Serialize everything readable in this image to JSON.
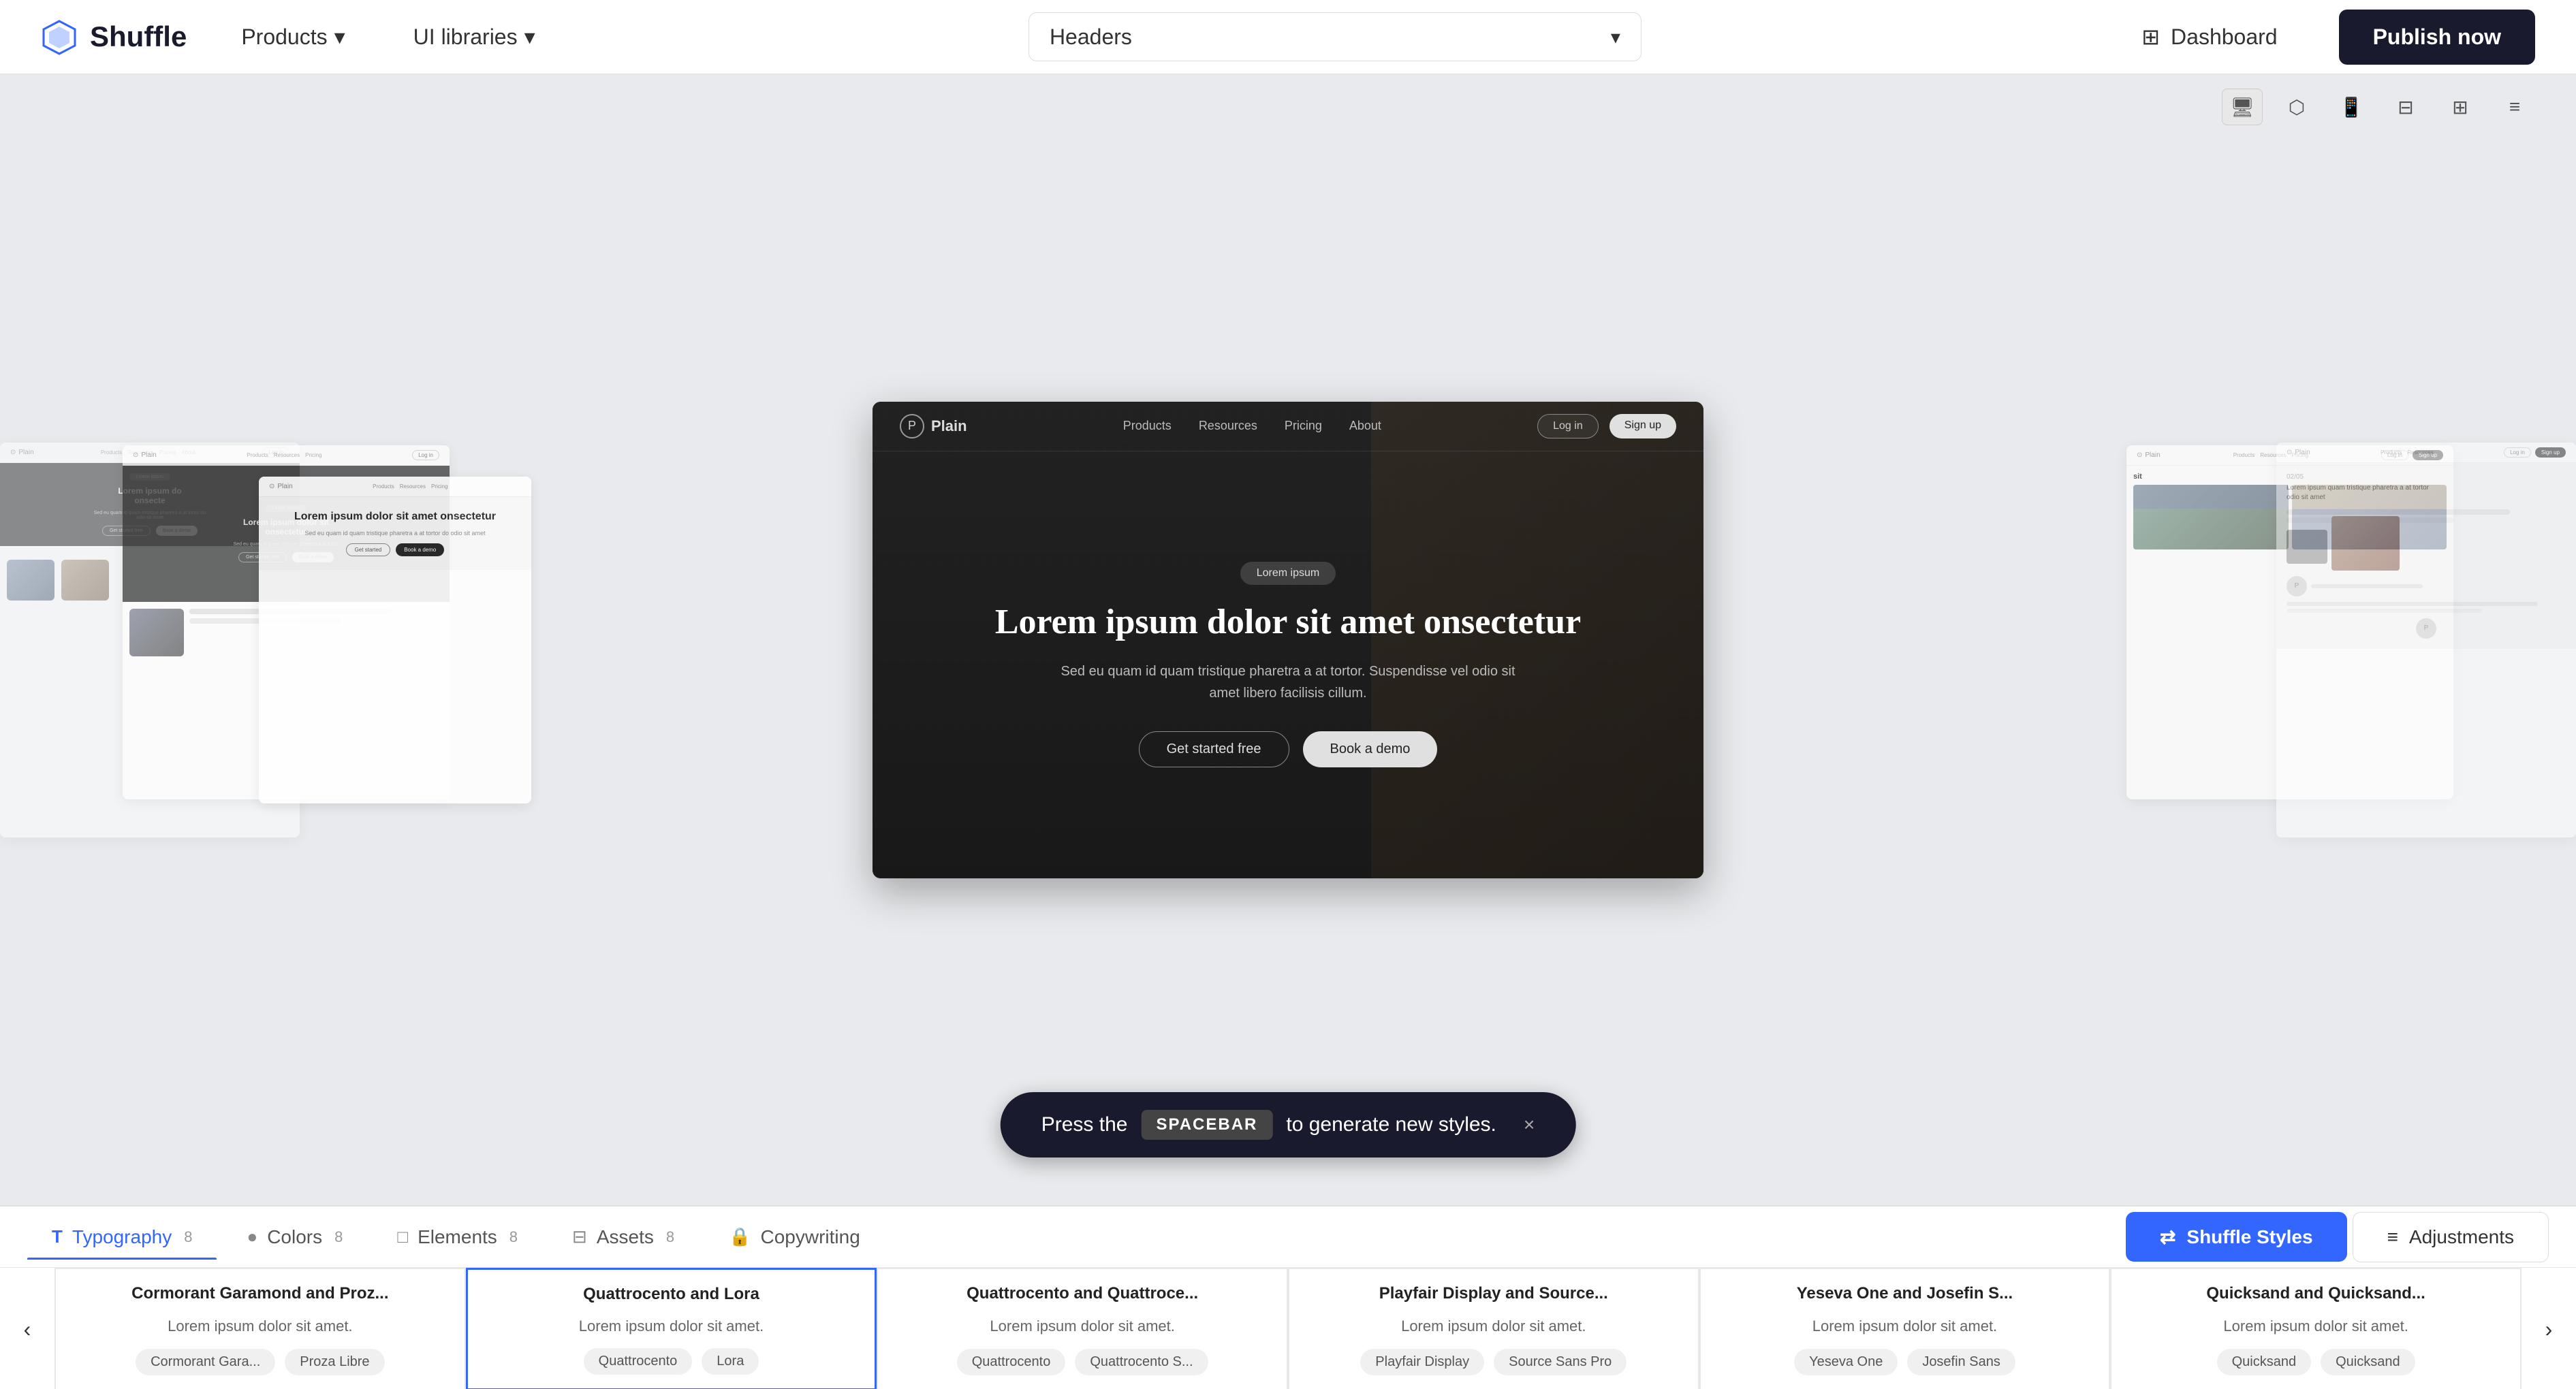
{
  "brand": {
    "name": "Shuffle",
    "logo_unicode": "⬡"
  },
  "topnav": {
    "products_label": "Products",
    "ui_libraries_label": "UI libraries",
    "search_placeholder": "Headers",
    "dashboard_label": "Dashboard",
    "publish_label": "Publish now"
  },
  "view_controls": [
    {
      "name": "desktop-view",
      "icon": "🖥",
      "active": true
    },
    {
      "name": "tablet-view",
      "icon": "⊟",
      "active": false
    },
    {
      "name": "mobile-view",
      "icon": "📱",
      "active": false
    },
    {
      "name": "split-view",
      "icon": "⊞",
      "active": false
    },
    {
      "name": "grid-view",
      "icon": "⊡",
      "active": false
    },
    {
      "name": "compact-view",
      "icon": "≡",
      "active": false
    }
  ],
  "preview": {
    "nav": {
      "logo": "Plain",
      "links": [
        "Products",
        "Resources",
        "Pricing",
        "About"
      ],
      "login_label": "Log in",
      "signup_label": "Sign up"
    },
    "hero": {
      "badge": "Lorem ipsum",
      "title": "Lorem ipsum dolor sit amet onsectetur",
      "subtitle": "Sed eu quam id quam tristique pharetra a at tortor. Suspendisse vel odio sit amet libero facilisis cillum.",
      "cta_primary": "Get started free",
      "cta_secondary": "Book a demo"
    }
  },
  "toast": {
    "prefix": "Press the",
    "key": "SPACEBAR",
    "suffix": "to generate new styles.",
    "close": "×"
  },
  "bottom_panel": {
    "tabs": [
      {
        "id": "typography",
        "label": "Typography",
        "badge": "8",
        "active": true,
        "icon": "T"
      },
      {
        "id": "colors",
        "label": "Colors",
        "badge": "8",
        "active": false,
        "icon": "●"
      },
      {
        "id": "elements",
        "label": "Elements",
        "badge": "8",
        "active": false,
        "icon": "□"
      },
      {
        "id": "assets",
        "label": "Assets",
        "badge": "8",
        "active": false,
        "icon": "⊟"
      },
      {
        "id": "copywriting",
        "label": "Copywriting",
        "badge": "",
        "active": false,
        "icon": "🔒",
        "locked": true
      }
    ],
    "shuffle_styles_label": "Shuffle Styles",
    "adjustments_label": "Adjustments"
  },
  "font_cards": [
    {
      "id": "cormorant-proz",
      "title": "Cormorant Garamond and Proz...",
      "sample": "Lorem ipsum dolor sit amet.",
      "tags": [
        "Cormorant Gara...",
        "Proza Libre"
      ],
      "selected": false
    },
    {
      "id": "quattrocento-lora",
      "title": "Quattrocento and Lora",
      "sample": "Lorem ipsum dolor sit amet.",
      "tags": [
        "Quattrocento",
        "Lora"
      ],
      "selected": true
    },
    {
      "id": "quattrocento-quattroce",
      "title": "Quattrocento and Quattroce...",
      "sample": "Lorem ipsum dolor sit amet.",
      "tags": [
        "Quattrocento",
        "Quattrocento S..."
      ],
      "selected": false
    },
    {
      "id": "playfair-source",
      "title": "Playfair Display and Source...",
      "sample": "Lorem ipsum dolor sit amet.",
      "tags": [
        "Playfair Display",
        "Source Sans Pro"
      ],
      "selected": false
    },
    {
      "id": "yeseva-josefin",
      "title": "Yeseva One and Josefin S...",
      "sample": "Lorem ipsum dolor sit amet.",
      "tags": [
        "Yeseva One",
        "Josefin Sans"
      ],
      "selected": false
    },
    {
      "id": "quicksand-quicksand",
      "title": "Quicksand and Quicksand...",
      "sample": "Lorem ipsum dolor sit amet.",
      "tags": [
        "Quicksand",
        "Quicksand"
      ],
      "selected": false
    }
  ],
  "left_nav_arrow": "‹",
  "right_nav_arrow": "›"
}
